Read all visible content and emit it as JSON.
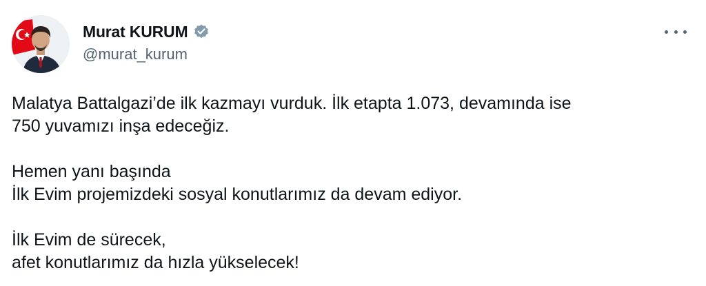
{
  "author": {
    "display_name": "Murat KURUM",
    "handle": "@murat_kurum",
    "verified": true,
    "verified_badge_color": "#829aab"
  },
  "icons": {
    "verified": "verified-badge-icon",
    "more": "more-options-icon",
    "avatar": "profile-photo"
  },
  "tweet": {
    "paragraphs": [
      [
        "Malatya Battalgazi’de ilk kazmayı vurduk. İlk etapta 1.073, devamında ise",
        "750 yuvamızı inşa edeceğiz."
      ],
      [
        "Hemen yanı başında",
        "İlk Evim projemizdeki sosyal konutlarımız da devam ediyor."
      ],
      [
        "İlk Evim de sürecek,",
        "afet konutlarımız da hızla yükselecek!"
      ]
    ]
  },
  "colors": {
    "text_primary": "#0f1419",
    "text_secondary": "#536471",
    "flag_red": "#e30a17"
  }
}
